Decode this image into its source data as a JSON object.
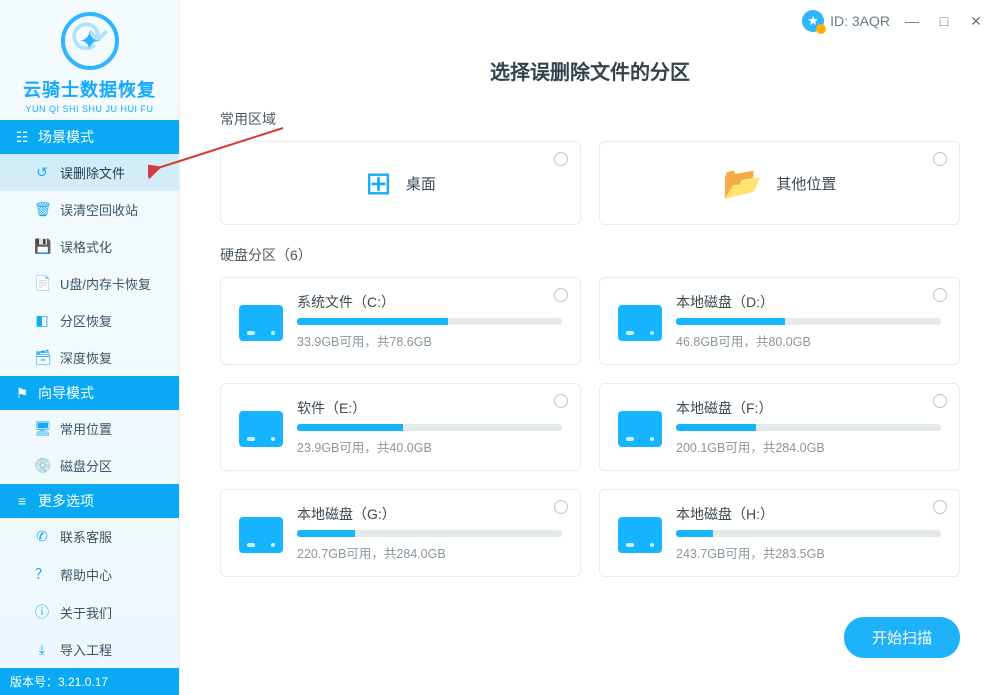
{
  "app": {
    "logo_title": "云骑士数据恢复",
    "logo_sub": "YUN QI SHI SHU JU HUI FU",
    "version_label": "版本号：3.21.0.17",
    "id_label": "ID: 3AQR"
  },
  "sections": {
    "scene": "场景模式",
    "wizard": "向导模式",
    "more": "更多选项"
  },
  "nav": {
    "scene": [
      {
        "label": "误删除文件",
        "icon": "↺"
      },
      {
        "label": "误清空回收站",
        "icon": "🗑"
      },
      {
        "label": "误格式化",
        "icon": "💾"
      },
      {
        "label": "U盘/内存卡恢复",
        "icon": "📄"
      },
      {
        "label": "分区恢复",
        "icon": "◧"
      },
      {
        "label": "深度恢复",
        "icon": "🗃"
      }
    ],
    "wizard": [
      {
        "label": "常用位置",
        "icon": "🖥"
      },
      {
        "label": "磁盘分区",
        "icon": "💿"
      }
    ],
    "more": [
      {
        "label": "联系客服",
        "icon": "✆"
      },
      {
        "label": "帮助中心",
        "icon": "？"
      },
      {
        "label": "关于我们",
        "icon": "ⓘ"
      },
      {
        "label": "导入工程",
        "icon": "⤓"
      }
    ]
  },
  "page": {
    "title": "选择误删除文件的分区",
    "common_label": "常用区域",
    "disk_label": "硬盘分区（6）",
    "scan_btn": "开始扫描"
  },
  "common_cards": [
    {
      "label": "桌面",
      "icon": "⊞"
    },
    {
      "label": "其他位置",
      "icon": "📂"
    }
  ],
  "drives": [
    {
      "name": "系统文件（C:）",
      "info": "33.9GB可用，共78.6GB",
      "pct": 57
    },
    {
      "name": "本地磁盘（D:）",
      "info": "46.8GB可用，共80.0GB",
      "pct": 41
    },
    {
      "name": "软件（E:）",
      "info": "23.9GB可用，共40.0GB",
      "pct": 40
    },
    {
      "name": "本地磁盘（F:）",
      "info": "200.1GB可用，共284.0GB",
      "pct": 30
    },
    {
      "name": "本地磁盘（G:）",
      "info": "220.7GB可用，共284.0GB",
      "pct": 22
    },
    {
      "name": "本地磁盘（H:）",
      "info": "243.7GB可用，共283.5GB",
      "pct": 14
    }
  ]
}
